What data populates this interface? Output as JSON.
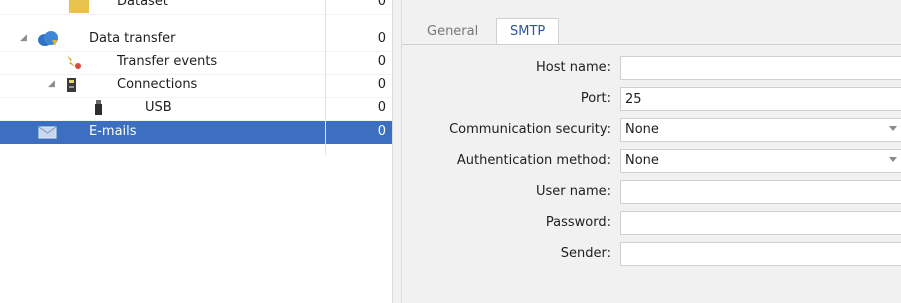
{
  "tree": {
    "rows": [
      {
        "label": "Dataset",
        "count": "0"
      },
      {
        "label": "Data transfer",
        "count": "0"
      },
      {
        "label": "Transfer events",
        "count": "0"
      },
      {
        "label": "Connections",
        "count": "0"
      },
      {
        "label": "USB",
        "count": "0"
      },
      {
        "label": "E-mails",
        "count": "0"
      }
    ],
    "icons": [
      "folder-icon",
      "cloud-transfer-icon",
      "transfer-events-icon",
      "connections-icon",
      "usb-icon",
      "envelope-icon"
    ],
    "selected_color": "#3c6fbf"
  },
  "tabs": [
    {
      "label": "General"
    },
    {
      "label": "SMTP",
      "active": true
    }
  ],
  "form": {
    "host_name": {
      "label": "Host name:",
      "value": ""
    },
    "port": {
      "label": "Port:",
      "value": "25"
    },
    "communication_security": {
      "label": "Communication security:",
      "value": "None"
    },
    "authentication_method": {
      "label": "Authentication method:",
      "value": "None"
    },
    "user_name": {
      "label": "User name:",
      "value": ""
    },
    "password": {
      "label": "Password:",
      "value": ""
    },
    "sender": {
      "label": "Sender:",
      "value": ""
    }
  }
}
